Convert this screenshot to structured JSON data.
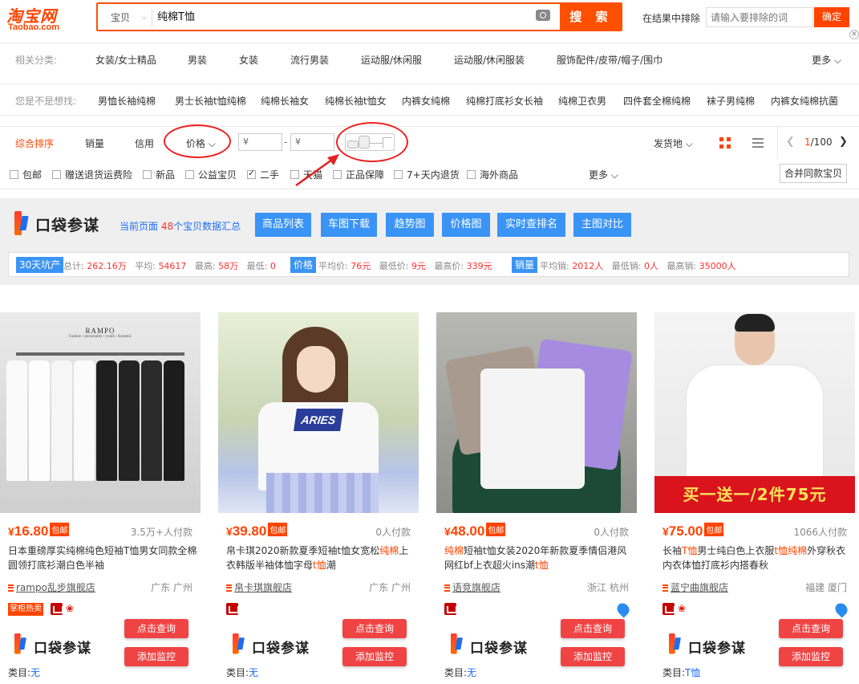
{
  "header": {
    "logo_cn": "淘宝网",
    "logo_en": "Taobao.com",
    "search_scope": "宝贝",
    "search_query": "纯棉T恤",
    "search_button": "搜 索",
    "exclude_label": "在结果中排除",
    "exclude_placeholder": "请输入要排除的词",
    "exclude_button": "确定"
  },
  "related": {
    "label": "相关分类:",
    "items": [
      "女装/女士精品",
      "男装",
      "女装",
      "流行男装",
      "运动服/休闲服",
      "运动服/休闲服装",
      "服饰配件/皮带/帽子/围巾"
    ],
    "more": "更多"
  },
  "suggest": {
    "label": "您是不是想找:",
    "items": [
      "男恤长袖纯棉",
      "男士长袖t恤纯棉",
      "纯棉长袖女",
      "纯棉长袖t恤女",
      "内裤女纯棉",
      "纯棉打底衫女长袖",
      "纯棉卫衣男",
      "四件套全棉纯棉",
      "袜子男纯棉",
      "内裤女纯棉抗菌"
    ]
  },
  "sort": {
    "items": [
      "综合排序",
      "销量",
      "信用",
      "价格"
    ],
    "price_min_placeholder": "¥",
    "price_max_placeholder": "¥",
    "dash": "-",
    "location": "发货地",
    "page_current": "1",
    "page_total": "/100"
  },
  "filters": {
    "items": [
      {
        "label": "包邮",
        "checked": false
      },
      {
        "label": "赠送退货运费险",
        "checked": false
      },
      {
        "label": "新品",
        "checked": false
      },
      {
        "label": "公益宝贝",
        "checked": false
      },
      {
        "label": "二手",
        "checked": true
      },
      {
        "label": "天猫",
        "checked": false
      },
      {
        "label": "正品保障",
        "checked": false
      },
      {
        "label": "7+天内退货",
        "checked": false
      },
      {
        "label": "海外商品",
        "checked": false
      }
    ],
    "more": "更多",
    "merge_button": "合并同款宝贝"
  },
  "plugin": {
    "name": "口袋参谋",
    "summary_prefix": "当前页面",
    "summary_count": "48",
    "summary_suffix": "个宝贝数据汇总",
    "buttons": [
      "商品列表",
      "车图下载",
      "趋势图",
      "价格图",
      "实时查排名",
      "主图对比"
    ],
    "stats": {
      "tag1": "30天坑产",
      "total_label": "总计:",
      "total": "262.16万",
      "avg_label": "平均:",
      "avg": "54617",
      "max_label": "最高:",
      "max": "58万",
      "min_label": "最低:",
      "min": "0",
      "tag2": "价格",
      "pavg_label": "平均价:",
      "pavg": "76元",
      "pmin_label": "最低价:",
      "pmin": "9元",
      "pmax_label": "最高价:",
      "pmax": "339元",
      "tag3": "销量",
      "savg_label": "平均销:",
      "savg": "2012人",
      "smin_label": "最低销:",
      "smin": "0人",
      "smax_label": "最高销:",
      "smax": "35000人"
    }
  },
  "products": [
    {
      "yen": "¥",
      "price": "16.80",
      "badge": "包邮",
      "sold": "3.5万+人付款",
      "title_parts": [
        "日本重磅厚实纯棉纯色短袖T恤男女同款全棉圆领打底衫潮白色半袖"
      ],
      "shop": "rampo乱步旗舰店",
      "location": "广东 广州",
      "hot_tag": "掌柜热卖",
      "image_brand": "RAMPO",
      "image_slogan": "Fashion / personality / youth / dynamic",
      "query_button": "点击查询",
      "monitor_button": "添加监控",
      "category_label": "类目:",
      "category": "无"
    },
    {
      "yen": "¥",
      "price": "39.80",
      "badge": "包邮",
      "sold": "0人付款",
      "title_parts": [
        "帛卡琪2020新款夏季短袖t恤女宽松",
        "纯棉",
        "上衣韩版半袖体恤字母",
        "t恤",
        "潮"
      ],
      "shop": "帛卡琪旗舰店",
      "location": "广东 广州",
      "image_text": "ARIES",
      "query_button": "点击查询",
      "monitor_button": "添加监控",
      "category_label": "类目:",
      "category": "无"
    },
    {
      "yen": "¥",
      "price": "48.00",
      "badge": "包邮",
      "sold": "0人付款",
      "title_parts": [
        "纯棉",
        "短袖t恤女装2020年新款夏季情侣港风网红bf上衣超火ins潮",
        "t恤"
      ],
      "shop": "语竞旗舰店",
      "location": "浙江 杭州",
      "query_button": "点击查询",
      "monitor_button": "添加监控",
      "category_label": "类目:",
      "category": "无"
    },
    {
      "yen": "¥",
      "price": "75.00",
      "badge": "包邮",
      "sold": "1066人付款",
      "title_parts": [
        "长袖",
        "T恤",
        "男士纯白色上衣服",
        "t恤",
        "纯棉",
        "外穿秋衣内衣体恤打底衫内搭春秋"
      ],
      "shop": "蓝宁曲旗舰店",
      "location": "福建 厦门",
      "image_banner": "买一送一/2件75元",
      "query_button": "点击查询",
      "monitor_button": "添加监控",
      "category_label": "类目:",
      "category": "T恤"
    }
  ],
  "colors": {
    "accent": "#ff5000",
    "plugin_blue": "#3a94f5",
    "annotation": "#e22222"
  }
}
